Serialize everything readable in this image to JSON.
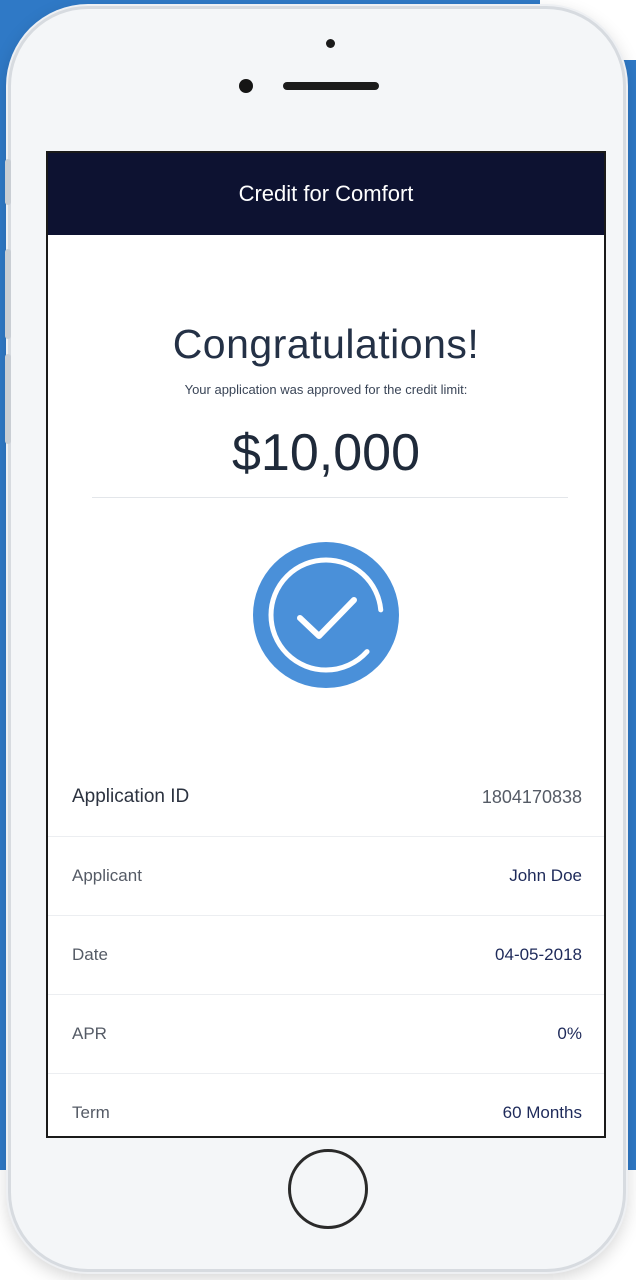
{
  "colors": {
    "background_blue": "#2f79c6",
    "navbar": "#0d1231",
    "accent": "#4a90d9"
  },
  "header": {
    "title": "Credit for Comfort"
  },
  "result": {
    "heading": "Congratulations!",
    "subtitle": "Your application was approved for the credit limit:",
    "amount": "$10,000",
    "status_icon": "check-circle-icon"
  },
  "details": [
    {
      "label": "Application ID",
      "value": "1804170838"
    },
    {
      "label": "Applicant",
      "value": "John Doe"
    },
    {
      "label": "Date",
      "value": "04-05-2018"
    },
    {
      "label": "APR",
      "value": "0%"
    },
    {
      "label": "Term",
      "value": "60 Months"
    }
  ]
}
